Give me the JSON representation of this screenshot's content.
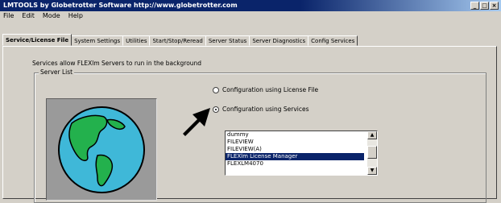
{
  "window": {
    "title": "LMTOOLS by Globetrotter Software http://www.globetrotter.com",
    "buttons": [
      "_",
      "□",
      "×"
    ]
  },
  "menu": [
    "File",
    "Edit",
    "Mode",
    "Help"
  ],
  "tabs": [
    {
      "label": "Service/License File",
      "active": true
    },
    {
      "label": "System Settings"
    },
    {
      "label": "Utilities"
    },
    {
      "label": "Start/Stop/Reread"
    },
    {
      "label": "Server Status"
    },
    {
      "label": "Server Diagnostics"
    },
    {
      "label": "Config Services"
    }
  ],
  "services_caption": "Services allow FLEXlm Servers to run in the background",
  "server_list_label": "Server List",
  "radio_license_file": "Configuration using License File",
  "radio_services": "Configuration using Services",
  "list_items": [
    {
      "label": "dummy"
    },
    {
      "label": "FILEVIEW"
    },
    {
      "label": "FILEVIEW(A)"
    },
    {
      "label": "FLEXlm License Manager",
      "selected": true
    },
    {
      "label": "FLEXLM4070"
    }
  ],
  "colors": {
    "titlebar": "#0a246a",
    "selection": "#0a246a",
    "globe_ocean": "#3fb8d8",
    "globe_land": "#23b14d"
  }
}
